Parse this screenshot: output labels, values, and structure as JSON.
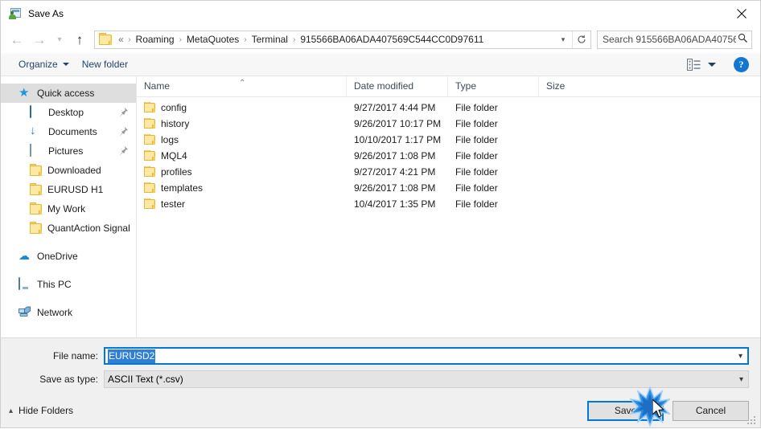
{
  "window": {
    "title": "Save As",
    "title_icon": "save-as-icon",
    "close_icon": "close-icon"
  },
  "nav": {
    "back_icon": "back-arrow-icon",
    "forward_icon": "forward-arrow-icon",
    "recent_icon": "chevron-down-icon",
    "up_icon": "up-arrow-icon",
    "folder_icon": "folder-icon",
    "breadcrumbs": [
      {
        "label": "«"
      },
      {
        "label": "Roaming"
      },
      {
        "label": "MetaQuotes"
      },
      {
        "label": "Terminal"
      },
      {
        "label": "915566BA06ADA407569C544CC0D97611"
      }
    ],
    "separator": "›",
    "dropdown_icon": "chevron-down-icon",
    "refresh_icon": "refresh-icon"
  },
  "search": {
    "placeholder": "Search 915566BA06ADA40756...",
    "icon": "search-icon"
  },
  "command_bar": {
    "organize_label": "Organize",
    "new_folder_label": "New folder",
    "view_icon": "view-mode-icon",
    "help_label": "?"
  },
  "sidebar": {
    "items": [
      {
        "label": "Quick access",
        "icon": "star-icon",
        "selected": true,
        "pinned": false,
        "indent": false
      },
      {
        "label": "Desktop",
        "icon": "desktop-icon",
        "selected": false,
        "pinned": true,
        "indent": true
      },
      {
        "label": "Documents",
        "icon": "documents-icon",
        "selected": false,
        "pinned": true,
        "indent": true
      },
      {
        "label": "Pictures",
        "icon": "pictures-icon",
        "selected": false,
        "pinned": true,
        "indent": true
      },
      {
        "label": "Downloaded",
        "icon": "folder-icon",
        "selected": false,
        "pinned": false,
        "indent": true
      },
      {
        "label": "EURUSD H1",
        "icon": "folder-icon",
        "selected": false,
        "pinned": false,
        "indent": true
      },
      {
        "label": "My Work",
        "icon": "folder-icon",
        "selected": false,
        "pinned": false,
        "indent": true
      },
      {
        "label": "QuantAction Signal",
        "icon": "folder-icon",
        "selected": false,
        "pinned": false,
        "indent": true
      },
      {
        "label": "OneDrive",
        "icon": "onedrive-icon",
        "selected": false,
        "pinned": false,
        "indent": false,
        "gap_before": true
      },
      {
        "label": "This PC",
        "icon": "this-pc-icon",
        "selected": false,
        "pinned": false,
        "indent": false,
        "gap_before": true
      },
      {
        "label": "Network",
        "icon": "network-icon",
        "selected": false,
        "pinned": false,
        "indent": false,
        "gap_before": true
      }
    ],
    "pin_icon": "pin-icon"
  },
  "file_list": {
    "columns": [
      "Name",
      "Date modified",
      "Type",
      "Size"
    ],
    "sort_indicator": "⌃",
    "rows": [
      {
        "name": "config",
        "date": "9/27/2017 4:44 PM",
        "type": "File folder",
        "size": ""
      },
      {
        "name": "history",
        "date": "9/26/2017 10:17 PM",
        "type": "File folder",
        "size": ""
      },
      {
        "name": "logs",
        "date": "10/10/2017 1:17 PM",
        "type": "File folder",
        "size": ""
      },
      {
        "name": "MQL4",
        "date": "9/26/2017 1:08 PM",
        "type": "File folder",
        "size": ""
      },
      {
        "name": "profiles",
        "date": "9/27/2017 4:21 PM",
        "type": "File folder",
        "size": ""
      },
      {
        "name": "templates",
        "date": "9/26/2017 1:08 PM",
        "type": "File folder",
        "size": ""
      },
      {
        "name": "tester",
        "date": "10/4/2017 1:35 PM",
        "type": "File folder",
        "size": ""
      }
    ]
  },
  "form": {
    "file_name_label": "File name:",
    "file_name_value": "EURUSD2",
    "save_as_type_label": "Save as type:",
    "save_as_type_value": "ASCII Text (*.csv)",
    "dropdown_icon": "chevron-down-icon"
  },
  "footer": {
    "hide_folders_label": "Hide Folders",
    "hide_folders_icon": "chevron-up-icon",
    "save_label": "Save",
    "cancel_label": "Cancel"
  },
  "colors": {
    "accent": "#0078d7",
    "selection": "#2f7fd4",
    "link_text": "#21456b",
    "folder": "#fbd96b",
    "help_blue": "#1177d1"
  }
}
